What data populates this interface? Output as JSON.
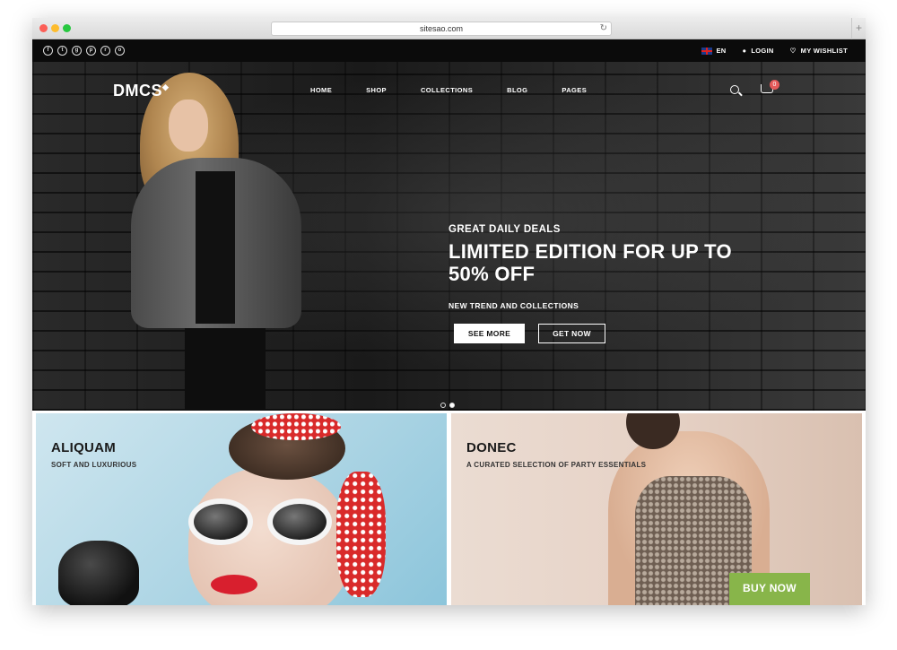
{
  "browser": {
    "url": "sitesao.com",
    "new_tab_glyph": "+",
    "reload_glyph": "↻"
  },
  "topbar": {
    "social_icons": [
      "facebook-icon",
      "twitter-icon",
      "google-plus-icon",
      "pinterest-icon",
      "rss-icon",
      "instagram-icon"
    ],
    "social_glyphs": [
      "f",
      "t",
      "g",
      "p",
      "r",
      "o"
    ],
    "language": "EN",
    "login": "LOGIN",
    "wishlist": "MY WISHLIST"
  },
  "header": {
    "logo": "DMCS",
    "logo_mark": "◆",
    "nav": [
      "HOME",
      "SHOP",
      "COLLECTIONS",
      "BLOG",
      "PAGES"
    ],
    "cart_count": "0"
  },
  "hero": {
    "eyebrow": "GREAT DAILY DEALS",
    "headline": "LIMITED EDITION FOR UP TO 50% OFF",
    "subtitle": "NEW TREND AND COLLECTIONS",
    "primary_button": "SEE MORE",
    "secondary_button": "GET NOW",
    "slides": 2,
    "active_slide": 2
  },
  "banners": {
    "left": {
      "title": "ALIQUAM",
      "subtitle": "SOFT AND LUXURIOUS"
    },
    "right": {
      "title": "DONEC",
      "subtitle": "A CURATED SELECTION OF PARTY ESSENTIALS",
      "button": "BUY NOW"
    }
  },
  "colors": {
    "topbar_bg": "#0b0b0b",
    "cart_badge": "#e55a5a",
    "buy_button": "#88b54a"
  }
}
